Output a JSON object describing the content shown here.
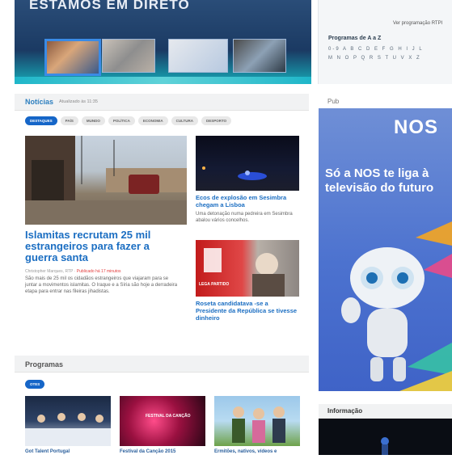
{
  "banner": {
    "title": "ESTAMOS EM DIRETO"
  },
  "programs_panel": {
    "link": "Ver programação RTPI",
    "az_title": "Programas de A a Z",
    "az_row1": "0-9 A B C D E F G H I J L",
    "az_row2": "M N O P Q R S T U V X Z"
  },
  "news": {
    "title": "Notícias",
    "updated": "Atualizado às 11:35",
    "tabs": [
      "DESTAQUES",
      "PAÍS",
      "MUNDO",
      "POLÍTICA",
      "ECONOMIA",
      "CULTURA",
      "DESPORTO"
    ],
    "main": {
      "headline": "Islamitas recrutam 25 mil estrangeiros para fazer a guerra santa",
      "byline": "Christopher Marques, RTP",
      "published": "Publicado há 17 minutos",
      "summary": "São mais de 25 mil os cidadãos estrangeiros que viajaram para se juntar a movimentos islamitas. O Iraque e a Síria são hoje a derradeira etapa para entrar nas fileiras jihadistas."
    },
    "side1": {
      "headline": "Ecos de explosão em Sesimbra chegam a Lisboa",
      "summary": "Uma detonação numa pedreira em Sesimbra abalou vários concelhos."
    },
    "side2": {
      "headline": "Roseta candidatava -se a Presidente da República se tivesse dinheiro",
      "tv_tag": "LEGA PARTIDO"
    }
  },
  "pub": {
    "label": "Pub",
    "brand": "NOS",
    "slogan": "Só a NOS te liga à televisão do futuro"
  },
  "programs": {
    "title": "Programas",
    "filter": "OTES",
    "items": [
      "Got Talent Portugal",
      "Festival da Canção 2015",
      "Ermitões, nativos, vídeos e"
    ],
    "thumb2_caption": "FESTIVAL DA CANÇÃO"
  },
  "info": {
    "title": "Informação"
  }
}
